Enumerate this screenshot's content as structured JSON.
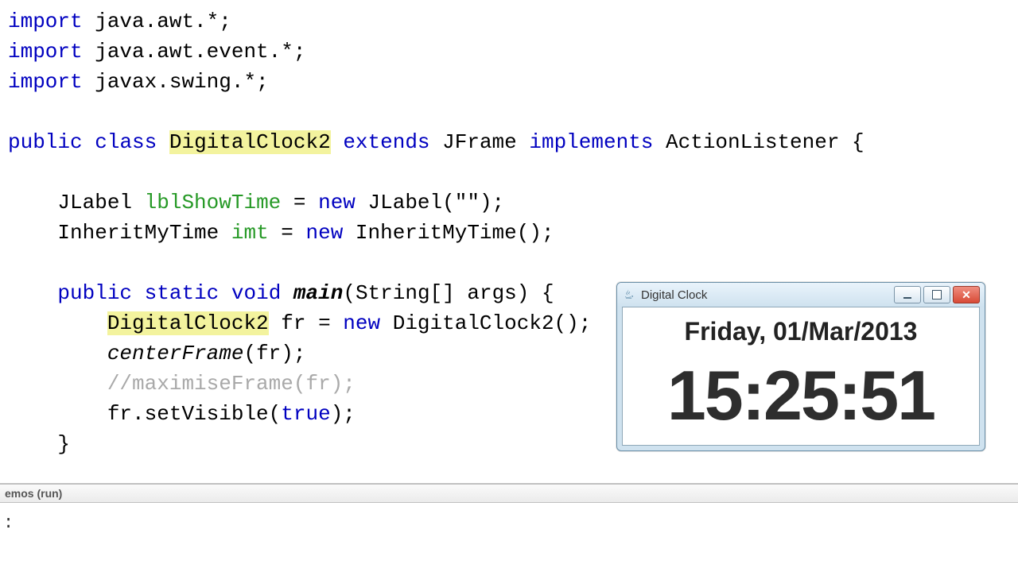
{
  "code": {
    "l1_kw": "import",
    "l1_rest": " java.awt.*;",
    "l2_kw": "import",
    "l2_rest": " java.awt.event.*;",
    "l3_kw": "import",
    "l3_rest": " javax.swing.*;",
    "l5_public": "public",
    "l5_class": "class",
    "l5_name": "DigitalClock2",
    "l5_extends": "extends",
    "l5_super": "JFrame",
    "l5_implements": "implements",
    "l5_iface": "ActionListener {",
    "l7_type": "JLabel ",
    "l7_field": "lblShowTime",
    "l7_eq": " = ",
    "l7_new": "new",
    "l7_ctor": " JLabel(",
    "l7_str": "\"\"",
    "l7_end": ");",
    "l8_type": "InheritMyTime ",
    "l8_field": "imt",
    "l8_eq": " = ",
    "l8_new": "new",
    "l8_ctor": " InheritMyTime();",
    "l10_public": "public",
    "l10_static": "static",
    "l10_void": "void",
    "l10_main": "main",
    "l10_args": "(String[] args) {",
    "l11_name": "DigitalClock2",
    "l11_var": " fr = ",
    "l11_new": "new",
    "l11_ctor": " DigitalClock2();",
    "l12": "centerFrame",
    "l12_after": "(fr);",
    "l13": "//maximiseFrame(fr);",
    "l14_pre": "fr.setVisible(",
    "l14_true": "true",
    "l14_post": ");",
    "l15": "}"
  },
  "console": {
    "tab": "emos (run)",
    "out": ":"
  },
  "window": {
    "title": "Digital Clock",
    "date": "Friday, 01/Mar/2013",
    "time": "15:25:51"
  }
}
